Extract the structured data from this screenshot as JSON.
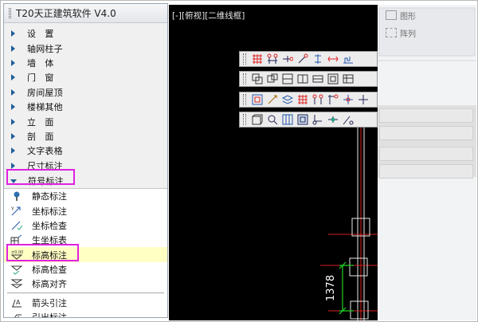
{
  "palette": {
    "title": "T20天正建筑软件 V4.0",
    "menu": [
      {
        "label": "设　置",
        "wide": true
      },
      {
        "label": "轴网柱子"
      },
      {
        "label": "墙　体",
        "wide": true
      },
      {
        "label": "门　窗",
        "wide": true
      },
      {
        "label": "房间屋顶"
      },
      {
        "label": "楼梯其他"
      },
      {
        "label": "立　面",
        "wide": true
      },
      {
        "label": "剖　面",
        "wide": true
      },
      {
        "label": "文字表格"
      },
      {
        "label": "尺寸标注"
      }
    ],
    "expanded": {
      "label": "符号标注"
    },
    "sub": [
      {
        "label": "静态标注",
        "icon": "pin-icon"
      },
      {
        "label": "坐标标注",
        "icon": "coordinate-mark-icon"
      },
      {
        "label": "坐标检查",
        "icon": "coordinate-check-icon"
      },
      {
        "label": "生坐标表",
        "icon": "coordinate-table-icon"
      },
      {
        "label": "标高标注",
        "icon": "elevation-mark-icon",
        "selected": true
      },
      {
        "label": "标高检查",
        "icon": "elevation-check-icon"
      },
      {
        "label": "标高对齐",
        "icon": "elevation-align-icon"
      },
      {
        "label": "箭头引注",
        "icon": "arrow-leader-icon"
      },
      {
        "label": "引出标注",
        "icon": "leader-note-icon"
      }
    ]
  },
  "canvas": {
    "view_label": "[-][俯视][二维线框]",
    "dimension_value": "1378"
  },
  "ribbon": {
    "groups": [
      "图形",
      "阵列"
    ]
  },
  "colors": {
    "highlight": "#e020e0",
    "selected_row": "#ffffc4",
    "arrow": "#1f5d99",
    "axis_red": "#d81e1e",
    "dim_green": "#22d022"
  }
}
